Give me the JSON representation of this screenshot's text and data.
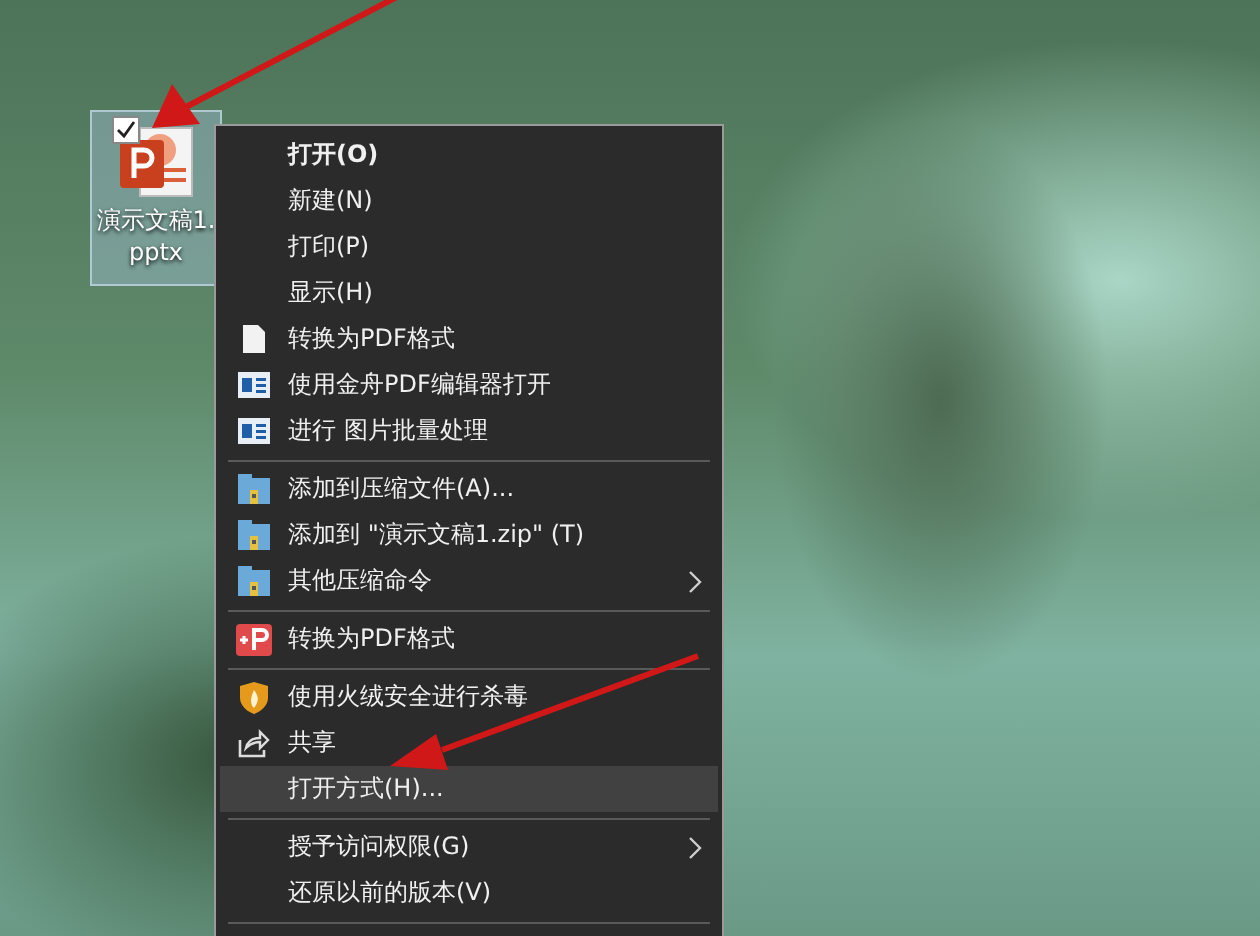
{
  "desktop_icon": {
    "label": "演示文稿1.pptx",
    "selected": true,
    "checked": true
  },
  "context_menu": {
    "items": [
      {
        "kind": "plain",
        "label": "打开(O)",
        "bold": true,
        "submenu": false,
        "selected": false
      },
      {
        "kind": "plain",
        "label": "新建(N)",
        "bold": false,
        "submenu": false,
        "selected": false
      },
      {
        "kind": "plain",
        "label": "打印(P)",
        "bold": false,
        "submenu": false,
        "selected": false
      },
      {
        "kind": "plain",
        "label": "显示(H)",
        "bold": false,
        "submenu": false,
        "selected": false
      },
      {
        "kind": "document",
        "label": "转换为PDF格式",
        "bold": false,
        "submenu": false,
        "selected": false
      },
      {
        "kind": "app",
        "label": "使用金舟PDF编辑器打开",
        "bold": false,
        "submenu": false,
        "selected": false
      },
      {
        "kind": "app",
        "label": "进行 图片批量处理",
        "bold": false,
        "submenu": false,
        "selected": false
      },
      {
        "kind": "separator"
      },
      {
        "kind": "archive",
        "label": "添加到压缩文件(A)...",
        "bold": false,
        "submenu": false,
        "selected": false
      },
      {
        "kind": "archive",
        "label": "添加到 \"演示文稿1.zip\" (T)",
        "bold": false,
        "submenu": false,
        "selected": false
      },
      {
        "kind": "archive",
        "label": "其他压缩命令",
        "bold": false,
        "submenu": true,
        "selected": false
      },
      {
        "kind": "separator"
      },
      {
        "kind": "pdf",
        "label": "转换为PDF格式",
        "bold": false,
        "submenu": false,
        "selected": false
      },
      {
        "kind": "separator"
      },
      {
        "kind": "shield",
        "label": "使用火绒安全进行杀毒",
        "bold": false,
        "submenu": false,
        "selected": false
      },
      {
        "kind": "share",
        "label": "共享",
        "bold": false,
        "submenu": false,
        "selected": false
      },
      {
        "kind": "plain",
        "label": "打开方式(H)...",
        "bold": false,
        "submenu": false,
        "selected": true
      },
      {
        "kind": "separator"
      },
      {
        "kind": "plain",
        "label": "授予访问权限(G)",
        "bold": false,
        "submenu": true,
        "selected": false
      },
      {
        "kind": "plain",
        "label": "还原以前的版本(V)",
        "bold": false,
        "submenu": false,
        "selected": false
      },
      {
        "kind": "separator"
      }
    ]
  }
}
